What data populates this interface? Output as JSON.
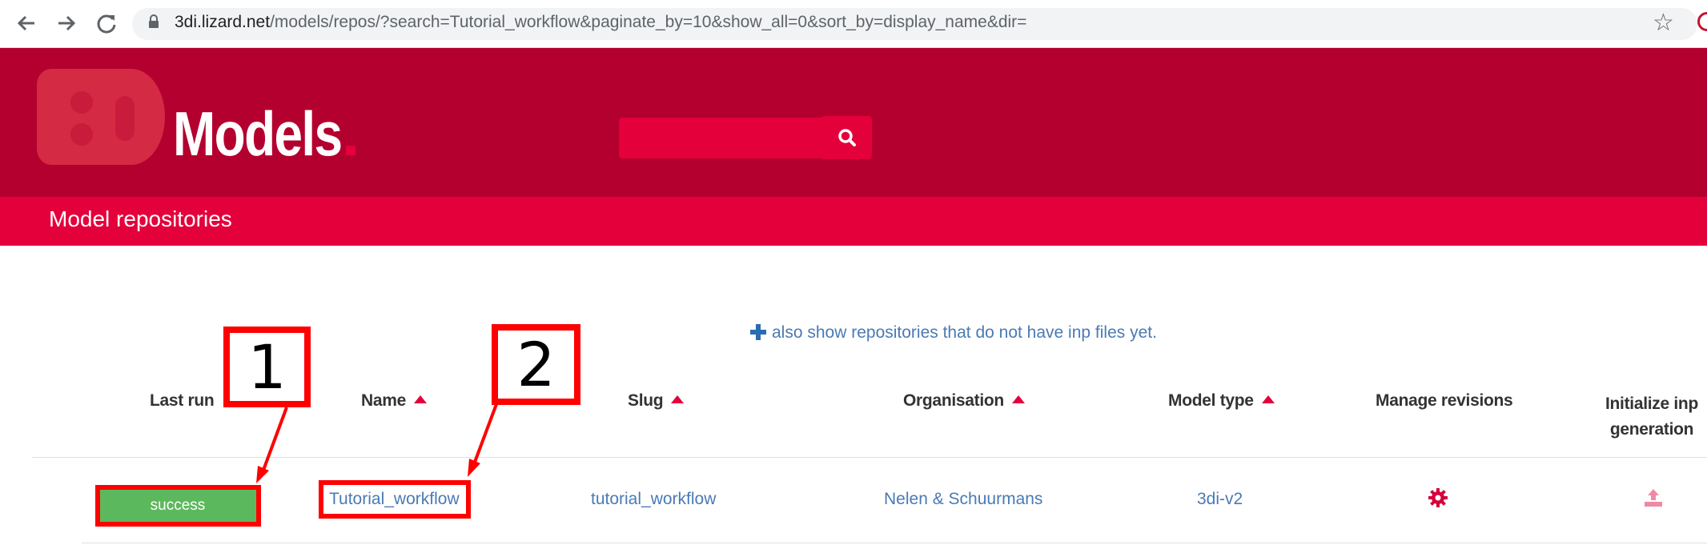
{
  "browser": {
    "url_host": "3di.lizard.net",
    "url_path": "/models/repos/?search=Tutorial_workflow&paginate_by=10&show_all=0&sort_by=display_name&dir="
  },
  "header": {
    "logo_text": "Models",
    "logo_mark": "3Di",
    "search_placeholder": ""
  },
  "subheader": {
    "title": "Model repositories"
  },
  "main": {
    "show_all_link": "also show repositories that do not have inp files yet.",
    "columns": [
      {
        "label": "Last run"
      },
      {
        "label": "Name"
      },
      {
        "label": "Slug"
      },
      {
        "label": "Organisation"
      },
      {
        "label": "Model type"
      },
      {
        "label": "Manage revisions"
      },
      {
        "label": "Initialize inp generation"
      }
    ],
    "rows": [
      {
        "last_run": "success",
        "name": "Tutorial_workflow",
        "slug": "tutorial_workflow",
        "organisation": "Nelen & Schuurmans",
        "model_type": "3di-v2"
      }
    ]
  },
  "annotations": [
    {
      "label": "1"
    },
    {
      "label": "2"
    }
  ],
  "colors": {
    "header_bg": "#b4002f",
    "accent": "#e4003b",
    "link": "#4a7ab5",
    "success": "#5cb85c",
    "annotation": "#ff0000"
  },
  "icons": {
    "back": "arrow-left-icon",
    "forward": "arrow-right-icon",
    "reload": "reload-icon",
    "lock": "lock-icon",
    "bookmark": "star-icon",
    "search": "search-icon",
    "plus": "plus-icon",
    "sort": "triangle-up-icon",
    "manage": "gear-icon",
    "initialize": "upload-icon"
  }
}
